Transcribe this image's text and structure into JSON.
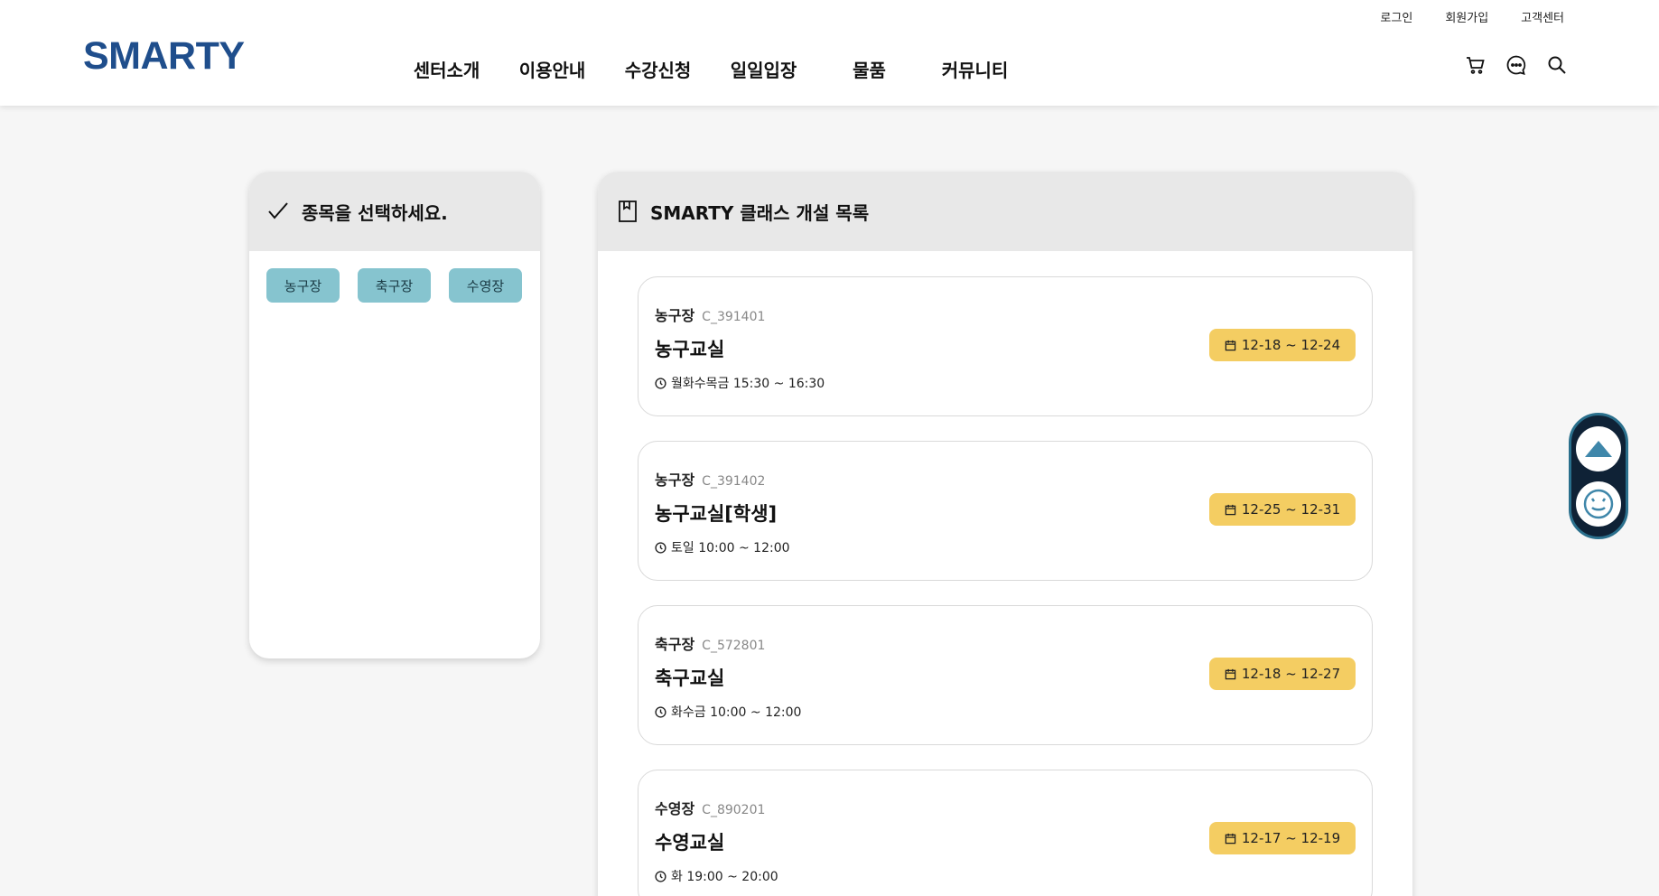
{
  "header": {
    "logo": "SMARTY",
    "util_links": [
      "로그인",
      "회원가입",
      "고객센터"
    ],
    "nav": [
      "센터소개",
      "이용안내",
      "수강신청",
      "일일입장",
      "물품",
      "커뮤니티"
    ],
    "icons": [
      "cart-icon",
      "chat-icon",
      "search-icon"
    ]
  },
  "left_panel": {
    "title": "종목을 선택하세요.",
    "chips": [
      "농구장",
      "축구장",
      "수영장"
    ]
  },
  "right_panel": {
    "title": "SMARTY 클래스 개설 목록",
    "classes": [
      {
        "category": "농구장",
        "code": "C_391401",
        "title": "농구교실",
        "schedule": "월화수목금 15:30 ~ 16:30",
        "period": "12-18 ~ 12-24"
      },
      {
        "category": "농구장",
        "code": "C_391402",
        "title": "농구교실[학생]",
        "schedule": "토일 10:00 ~ 12:00",
        "period": "12-25 ~ 12-31"
      },
      {
        "category": "축구장",
        "code": "C_572801",
        "title": "축구교실",
        "schedule": "화수금 10:00 ~ 12:00",
        "period": "12-18 ~ 12-27"
      },
      {
        "category": "수영장",
        "code": "C_890201",
        "title": "수영교실",
        "schedule": "화 19:00 ~ 20:00",
        "period": "12-17 ~ 12-19"
      }
    ]
  },
  "colors": {
    "brand": "#1f4e8c",
    "chip": "#86c4cf",
    "badge": "#f4cd62",
    "floating": "#0f2236"
  }
}
